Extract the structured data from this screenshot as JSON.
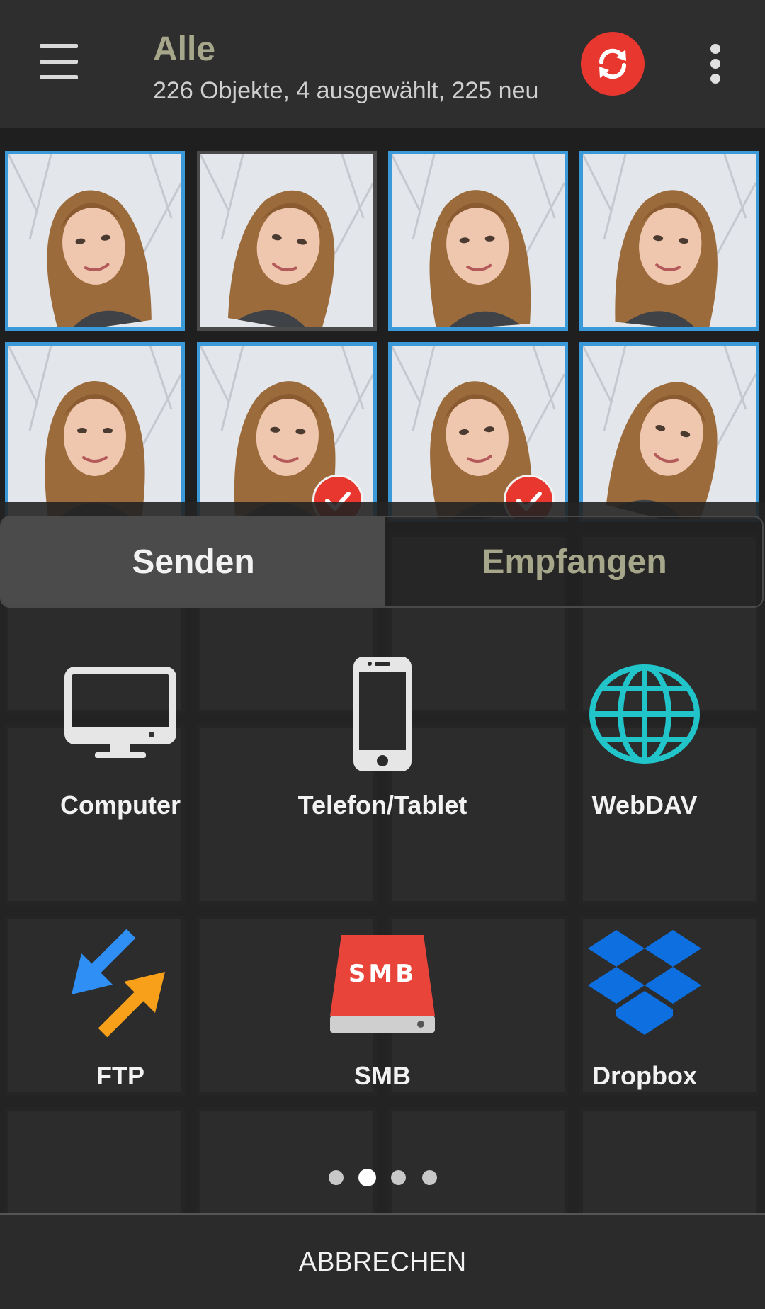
{
  "header": {
    "title": "Alle",
    "subtitle": "226 Objekte, 4 ausgewählt, 225 neu",
    "menu_icon": "hamburger-menu-icon",
    "sync_icon": "sync-icon",
    "overflow_icon": "more-vert-icon"
  },
  "colors": {
    "accent_red": "#e8372f",
    "selection_blue": "#3a9ad9",
    "title_olive": "#a6a68a",
    "webdav_teal": "#21c4c9",
    "dropbox_blue": "#0d6fe0",
    "ftp_blue": "#2f8ff5",
    "ftp_orange": "#f9a01b"
  },
  "photos": [
    {
      "selected": true,
      "checked": false
    },
    {
      "selected": false,
      "checked": false
    },
    {
      "selected": true,
      "checked": false
    },
    {
      "selected": true,
      "checked": false
    },
    {
      "selected": true,
      "checked": false
    },
    {
      "selected": true,
      "checked": true
    },
    {
      "selected": true,
      "checked": true
    },
    {
      "selected": true,
      "checked": false
    }
  ],
  "sheet": {
    "tabs": [
      {
        "label": "Senden",
        "active": true
      },
      {
        "label": "Empfangen",
        "active": false
      }
    ],
    "targets": [
      {
        "label": "Computer",
        "icon": "computer-icon"
      },
      {
        "label": "Telefon/Tablet",
        "icon": "phone-icon"
      },
      {
        "label": "WebDAV",
        "icon": "globe-icon"
      },
      {
        "label": "FTP",
        "icon": "ftp-arrows-icon"
      },
      {
        "label": "SMB",
        "icon": "smb-drive-icon",
        "icon_text": "SMB"
      },
      {
        "label": "Dropbox",
        "icon": "dropbox-icon"
      }
    ],
    "pages": {
      "total": 4,
      "current": 2
    },
    "cancel_label": "ABBRECHEN"
  }
}
